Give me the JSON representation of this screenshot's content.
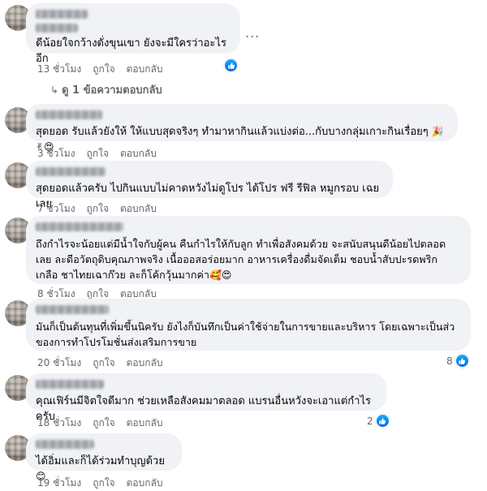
{
  "more_options_label": "...",
  "replies_link": {
    "arrow": "↳",
    "text": "ดู 1 ข้อความตอบกลับ"
  },
  "action_like": "ถูกใจ",
  "action_reply": "ตอบกลับ",
  "comments": [
    {
      "text": "ดีน้อยใจกว้างดั่งขุนเขา ยังจะมีใครว่าอะไรอีก",
      "time": "13 ชั่วโมง",
      "reaction_count": ""
    },
    {
      "text": "สุดยอด รับแล้วยังให้ ให้แบบสุดจริงๆ ทำมาหากินแล้วแบ่งต่อ...กับบางกลุ่มเกาะกินเรื่อยๆ",
      "emoji": "🎉✌😍",
      "time": "3 ชั่วโมง",
      "reaction_count": ""
    },
    {
      "text": "สุดยอดแล้วครับ ไปกินแบบไม่คาดหวังไม่ดูโปร ได้โปร ฟรี รีฟิล หมูกรอบ เฉยเลย",
      "time": "7 ชั่วโมง",
      "reaction_count": ""
    },
    {
      "text": "ถึงกำไรจะน้อยแต่มีน้ำใจกับผู้คน คืนกำไรให้กับลูก ทำเพื่อสังคมด้วย จะสนับสนุนดีน้อยไปตลอด\nเลย ละดีอวัตถุดิบคุณภาพจริง เนื้อออสอร่อยมาก อาหารเครื่องดื่มจัดเต็ม ชอบน้ำสับปะรดพริก\nเกลือ ชาไทยเฉาก๊วย ละก็โค้กวุ้นมากค่า",
      "emoji": "🥰😍",
      "time": "8 ชั่วโมง",
      "reaction_count": ""
    },
    {
      "text": "มันก็เป็นต้นทุนที่เพิ่มขึ้นนิครับ ยังไงก็บันทึกเป็นค่าใช้จ่ายในการขายและบริหาร โดยเฉพาะเป็นส่ว\nของการทำโปรโมชั่นส่งเสริมการขาย",
      "time": "20 ชั่วโมง",
      "reaction_count": "8"
    },
    {
      "text": "คุณเฟิร์นมีจิตใจดีมาก ช่วยเหลือสังคมมาตลอด แบรนอื่นหวังจะเอาแต่กำไร ครับ",
      "time": "18 ชั่วโมง",
      "reaction_count": "2"
    },
    {
      "text": "ได้อิ่มและก็ได้ร่วมทำบุญด้วย",
      "emoji": "😊",
      "time": "19 ชั่วโมง",
      "reaction_count": ""
    }
  ]
}
